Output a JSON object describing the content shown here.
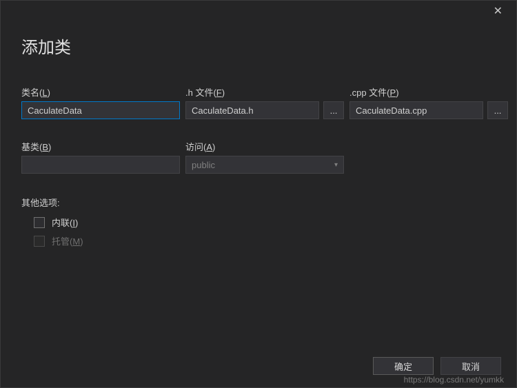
{
  "dialog": {
    "title": "添加类"
  },
  "fields": {
    "className": {
      "label": "类名(",
      "mnem": "L",
      "labelEnd": ")",
      "value": "CaculateData"
    },
    "hFile": {
      "label": ".h 文件(",
      "mnem": "F",
      "labelEnd": ")",
      "value": "CaculateData.h",
      "browse": "..."
    },
    "cppFile": {
      "label": ".cpp 文件(",
      "mnem": "P",
      "labelEnd": ")",
      "value": "CaculateData.cpp",
      "browse": "..."
    },
    "baseClass": {
      "label": "基类(",
      "mnem": "B",
      "labelEnd": ")",
      "value": ""
    },
    "access": {
      "label": "访问(",
      "mnem": "A",
      "labelEnd": ")",
      "value": "public"
    }
  },
  "options": {
    "title": "其他选项:",
    "inline": {
      "label": "内联(",
      "mnem": "I",
      "labelEnd": ")"
    },
    "managed": {
      "label": "托管(",
      "mnem": "M",
      "labelEnd": ")"
    }
  },
  "buttons": {
    "ok": "确定",
    "cancel": "取消"
  },
  "watermark": "https://blog.csdn.net/yumkk"
}
